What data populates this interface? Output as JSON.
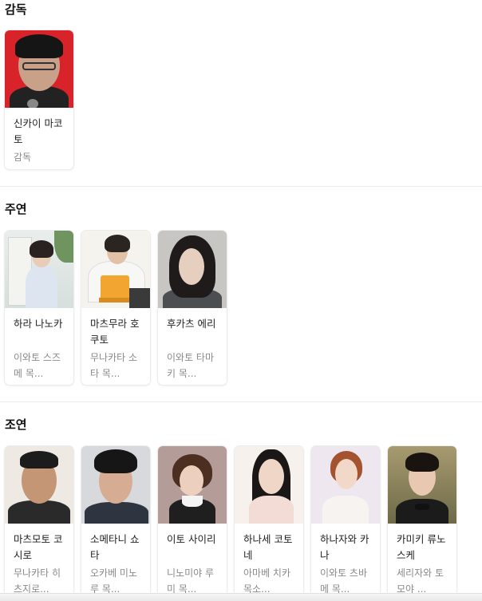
{
  "sections": {
    "director": {
      "title": "감독",
      "cards": [
        {
          "name": "신카이 마코토",
          "role": "감독"
        }
      ]
    },
    "main_cast": {
      "title": "주연",
      "cards": [
        {
          "name": "하라 나노카",
          "role": "이와토 스즈메 목..."
        },
        {
          "name": "마츠무라 호쿠토",
          "role": "무나카타 소타 목..."
        },
        {
          "name": "후카츠 에리",
          "role": "이와토 타마키 목..."
        }
      ]
    },
    "supporting_cast": {
      "title": "조연",
      "cards": [
        {
          "name": "마츠모토 코시로",
          "role": "무나카타 히츠지로..."
        },
        {
          "name": "소메타니 쇼타",
          "role": "오카베 미노루 목..."
        },
        {
          "name": "이토 사이리",
          "role": "니노미야 루미 목..."
        },
        {
          "name": "하나세 코토네",
          "role": "아마베 치카 목소..."
        },
        {
          "name": "하나자와 카나",
          "role": "이와토 츠바메 목..."
        },
        {
          "name": "카미키 류노스케",
          "role": "세리자와 토모야 ..."
        }
      ]
    }
  }
}
